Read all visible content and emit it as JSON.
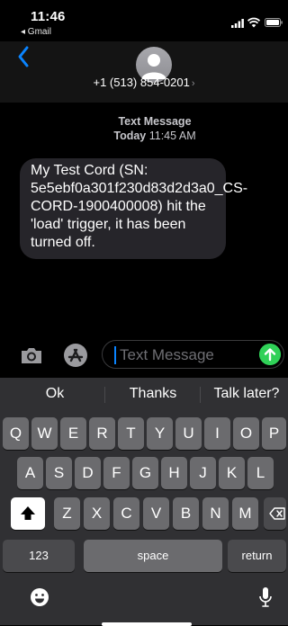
{
  "status_bar": {
    "time": "11:46",
    "back_app": "◂ Gmail"
  },
  "header": {
    "contact": "+1 (513) 854-0201",
    "chevron": "›"
  },
  "conversation": {
    "service_label": "Text Message",
    "day": "Today",
    "time": "11:45 AM",
    "message": "My Test Cord (SN: 5e5ebf0a301f230d83d2d3a0_CS-CORD-1900400008) hit the 'load' trigger, it has been turned off."
  },
  "composer": {
    "placeholder": "Text Message"
  },
  "keyboard": {
    "suggestions": [
      "Ok",
      "Thanks",
      "Talk later?"
    ],
    "row1": [
      "Q",
      "W",
      "E",
      "R",
      "T",
      "Y",
      "U",
      "I",
      "O",
      "P"
    ],
    "row2": [
      "A",
      "S",
      "D",
      "F",
      "G",
      "H",
      "J",
      "K",
      "L"
    ],
    "row3": [
      "Z",
      "X",
      "C",
      "V",
      "B",
      "N",
      "M"
    ],
    "numbers_key": "123",
    "space_key": "space",
    "return_key": "return"
  },
  "colors": {
    "accent": "#0a84ff",
    "send": "#30d158",
    "bubble": "#26252a"
  }
}
